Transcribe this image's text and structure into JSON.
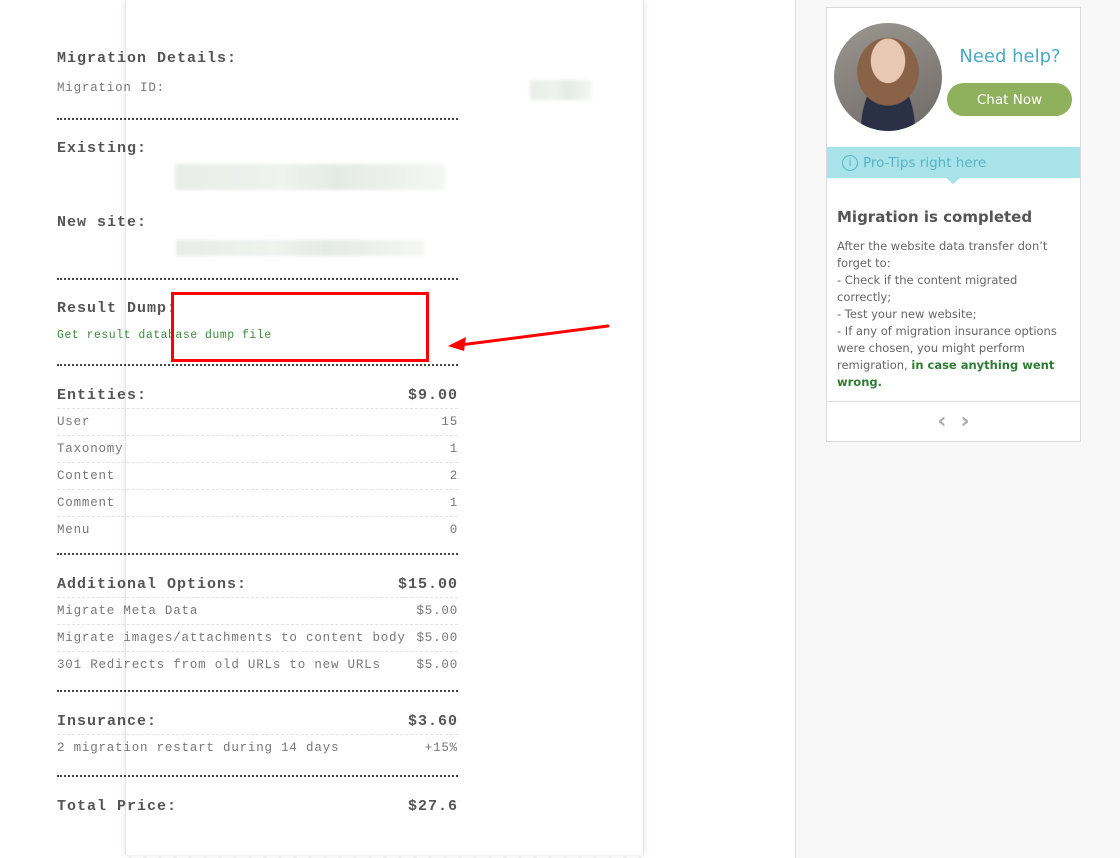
{
  "receipt": {
    "details_title": "Migration Details:",
    "migration_id_label": "Migration ID:",
    "existing_label": "Existing:",
    "new_site_label": "New site:",
    "result_dump_label": "Result Dump:",
    "result_dump_link": "Get result database dump file",
    "entities": {
      "label": "Entities:",
      "total": "$9.00",
      "rows": [
        {
          "name": "User",
          "value": "15"
        },
        {
          "name": "Taxonomy",
          "value": "1"
        },
        {
          "name": "Content",
          "value": "2"
        },
        {
          "name": "Comment",
          "value": "1"
        },
        {
          "name": "Menu",
          "value": "0"
        }
      ]
    },
    "additional": {
      "label": "Additional Options:",
      "total": "$15.00",
      "rows": [
        {
          "name": "Migrate Meta Data",
          "value": "$5.00"
        },
        {
          "name": "Migrate images/attachments to content body",
          "value": "$5.00"
        },
        {
          "name": "301 Redirects from old URLs to new URLs",
          "value": "$5.00"
        }
      ]
    },
    "insurance": {
      "label": "Insurance:",
      "total": "$3.60",
      "rows": [
        {
          "name": "2 migration restart during 14 days",
          "value": "+15%"
        }
      ]
    },
    "total": {
      "label": "Total Price:",
      "value": "$27.6"
    }
  },
  "help_widget": {
    "need_help": "Need help?",
    "chat_button": "Chat Now",
    "tips_label": "Pro-Tips right here",
    "tip_title": "Migration is completed",
    "tip_lines": [
      "After the website data transfer don’t forget to:",
      "- Check if the content migrated correctly;",
      "- Test your new website;",
      "- If any of migration insurance options were chosen, you might perform remigration, "
    ],
    "tip_highlight": "in case anything went wrong.",
    "prev_icon": "‹",
    "next_icon": "›"
  },
  "colors": {
    "accent_green": "#8fb05c",
    "link_green": "#3d8b3d",
    "help_blue": "#4aa9c2",
    "tips_bg": "#a8e3ea",
    "annotation_red": "#ff0000"
  }
}
